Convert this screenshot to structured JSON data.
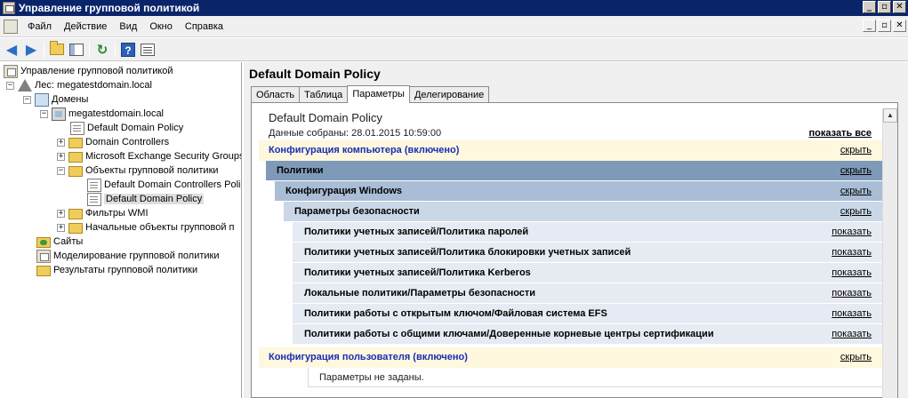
{
  "window": {
    "title": "Управление групповой политикой",
    "controls": [
      "_",
      "▫",
      "✕"
    ],
    "inner_controls": [
      "_",
      "▫",
      "✕"
    ]
  },
  "menu": [
    "Файл",
    "Действие",
    "Вид",
    "Окно",
    "Справка"
  ],
  "toolbar": {
    "buttons": [
      "back-icon",
      "forward-icon",
      "up-folder-icon",
      "show-hide-tree-icon",
      "refresh-icon",
      "help-icon",
      "properties-icon"
    ]
  },
  "tree": {
    "root": "Управление групповой политикой",
    "forest": "Лес: megatestdomain.local",
    "domains": "Домены",
    "domain": "megatestdomain.local",
    "default_policy": "Default Domain Policy",
    "domain_controllers": "Domain Controllers",
    "exchange_groups": "Microsoft Exchange Security Groups",
    "gpo_folder": "Объекты групповой политики",
    "gpo_dc_policy": "Default Domain Controllers Polic",
    "gpo_default_policy": "Default Domain Policy",
    "wmi_filters": "Фильтры WMI",
    "starter_gpos": "Начальные объекты групповой п",
    "sites": "Сайты",
    "modeling": "Моделирование групповой политики",
    "results": "Результаты групповой политики"
  },
  "panel": {
    "title": "Default Domain Policy",
    "tabs": [
      "Область",
      "Таблица",
      "Параметры",
      "Делегирование"
    ],
    "active_tab": "Параметры"
  },
  "report": {
    "title": "Default Domain Policy",
    "collected": "Данные собраны: 28.01.2015 10:59:00",
    "show_all": "показать все",
    "computer_config": "Конфигурация компьютера (включено)",
    "policies": "Политики",
    "windows_config": "Конфигурация Windows",
    "security_settings": "Параметры безопасности",
    "items": [
      "Политики учетных записей/Политика паролей",
      "Политики учетных записей/Политика блокировки учетных записей",
      "Политики учетных записей/Политика Kerberos",
      "Локальные политики/Параметры безопасности",
      "Политики работы с открытым ключом/Файловая система EFS",
      "Политики работы с общими ключами/Доверенные корневые центры сертификации"
    ],
    "user_config": "Конфигурация пользователя (включено)",
    "not_set": "Параметры не заданы.",
    "hide": "скрыть",
    "show": "показать"
  }
}
